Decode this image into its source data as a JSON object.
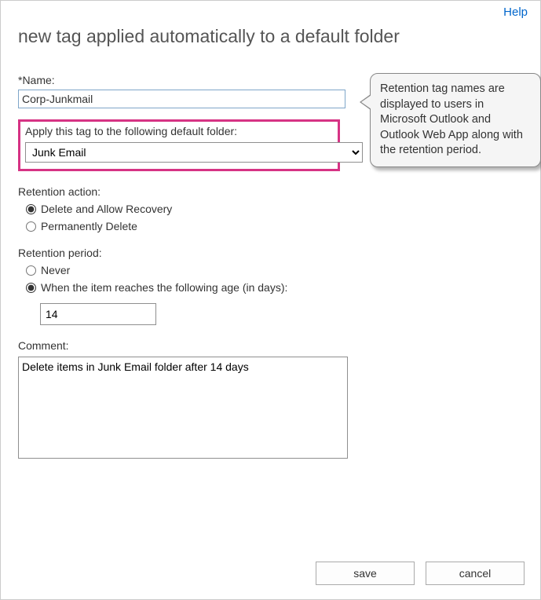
{
  "help_link": "Help",
  "page_title": "new tag applied automatically to a default folder",
  "name": {
    "label": "*Name:",
    "value": "Corp-Junkmail"
  },
  "apply_tag": {
    "label": "Apply this tag to the following default folder:",
    "selected": "Junk Email"
  },
  "retention_action": {
    "label": "Retention action:",
    "options": [
      {
        "label": "Delete and Allow Recovery",
        "selected": true
      },
      {
        "label": "Permanently Delete",
        "selected": false
      }
    ]
  },
  "retention_period": {
    "label": "Retention period:",
    "options": [
      {
        "label": "Never",
        "selected": false
      },
      {
        "label": "When the item reaches the following age (in days):",
        "selected": true
      }
    ],
    "days_value": "14"
  },
  "comment": {
    "label": "Comment:",
    "value": "Delete items in Junk Email folder after 14 days"
  },
  "callout_text": "Retention tag names are displayed to users in Microsoft Outlook and Outlook Web App along with the retention period.",
  "buttons": {
    "save": "save",
    "cancel": "cancel"
  }
}
